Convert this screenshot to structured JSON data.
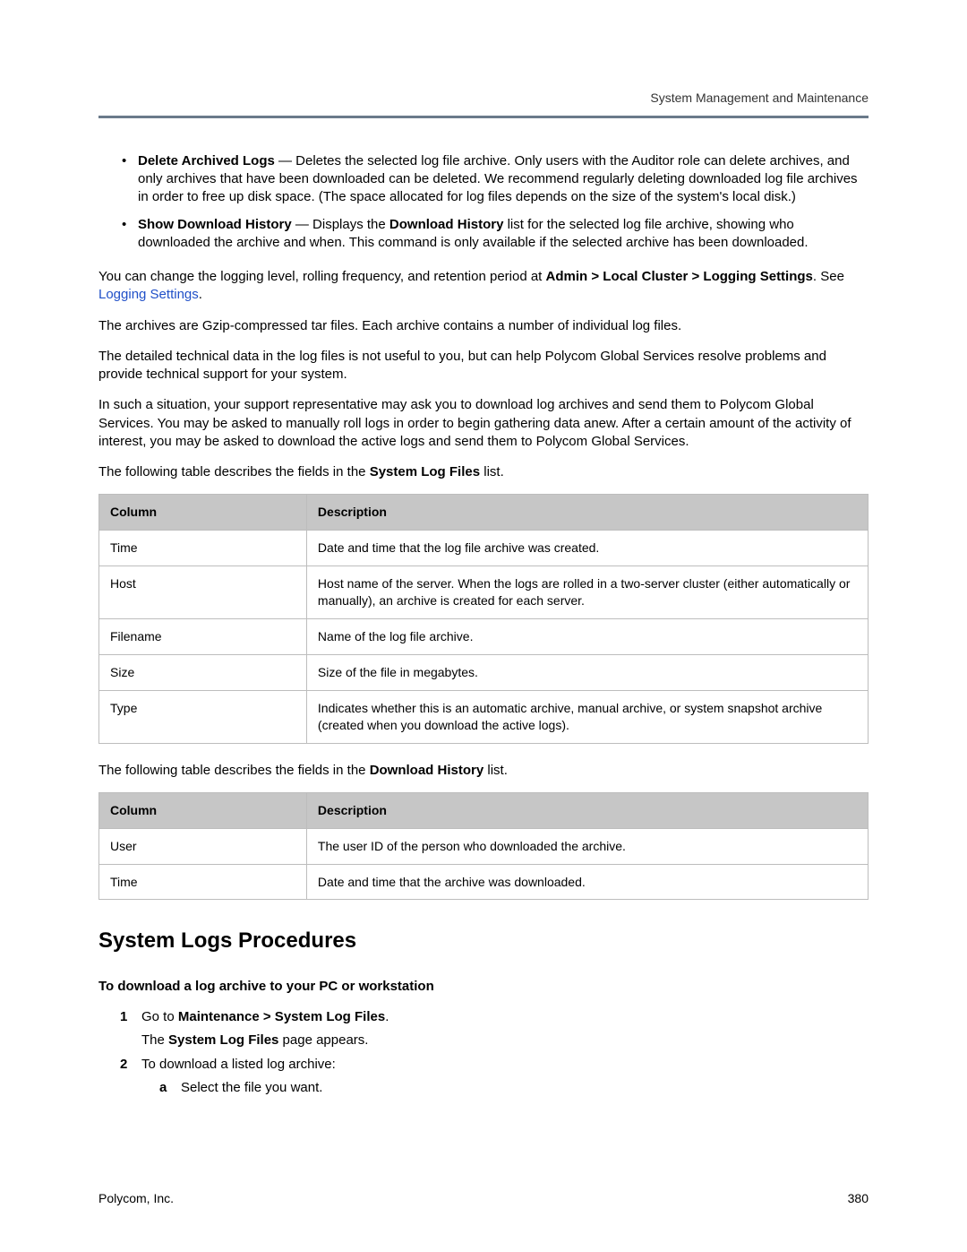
{
  "header": {
    "section": "System Management and Maintenance"
  },
  "bullets": [
    {
      "strong": "Delete Archived Logs",
      "rest": " — Deletes the selected log file archive. Only users with the Auditor role can delete archives, and only archives that have been downloaded can be deleted. We recommend regularly deleting downloaded log file archives in order to free up disk space. (The space allocated for log files depends on the size of the system's local disk.)"
    },
    {
      "strong": "Show Download History",
      "rest_before": " — Displays the ",
      "rest_mid_bold": "Download History",
      "rest_after": " list for the selected log file archive, showing who downloaded the archive and when. This command is only available if the selected archive has been downloaded."
    }
  ],
  "para_change_a": "You can change the logging level, rolling frequency, and retention period at ",
  "para_change_bold": "Admin > Local Cluster > Logging Settings",
  "para_change_b": ". See ",
  "para_change_link": "Logging Settings",
  "para_change_c": ".",
  "para_archives": "The archives are Gzip-compressed tar files. Each archive contains a number of individual log files.",
  "para_technical": "The detailed technical data in the log files is not useful to you, but can help Polycom Global Services resolve problems and provide technical support for your system.",
  "para_support": "In such a situation, your support representative may ask you to download log archives and send them to Polycom Global Services. You may be asked to manually roll logs in order to begin gathering data anew. After a certain amount of the activity of interest, you may be asked to download the active logs and send them to Polycom Global Services.",
  "para_table1_intro_a": "The following table describes the fields in the ",
  "para_table1_intro_bold": "System Log Files",
  "para_table1_intro_b": " list.",
  "table1": {
    "head": {
      "c1": "Column",
      "c2": "Description"
    },
    "rows": [
      {
        "c1": "Time",
        "c2": "Date and time that the log file archive was created."
      },
      {
        "c1": "Host",
        "c2": "Host name of the server. When the logs are rolled in a two-server cluster (either automatically or manually), an archive is created for each server."
      },
      {
        "c1": "Filename",
        "c2": "Name of the log file archive."
      },
      {
        "c1": "Size",
        "c2": "Size of the file in megabytes."
      },
      {
        "c1": "Type",
        "c2": "Indicates whether this is an automatic archive, manual archive, or system snapshot archive (created when you download the active logs)."
      }
    ]
  },
  "para_table2_intro_a": "The following table describes the fields in the ",
  "para_table2_intro_bold": "Download History",
  "para_table2_intro_b": " list.",
  "table2": {
    "head": {
      "c1": "Column",
      "c2": "Description"
    },
    "rows": [
      {
        "c1": "User",
        "c2": "The user ID of the person who downloaded the archive."
      },
      {
        "c1": "Time",
        "c2": "Date and time that the archive was downloaded."
      }
    ]
  },
  "section_heading": "System Logs Procedures",
  "subhead": "To download a log archive to your PC or workstation",
  "steps": {
    "n1": "1",
    "s1_a": "Go to ",
    "s1_bold": "Maintenance > System Log Files",
    "s1_b": ".",
    "s1_line2_a": "The ",
    "s1_line2_bold": "System Log Files",
    "s1_line2_b": " page appears.",
    "n2": "2",
    "s2": "To download a listed log archive:",
    "sa_letter": "a",
    "sa_text": "Select the file you want."
  },
  "footer": {
    "left": "Polycom, Inc.",
    "right": "380"
  }
}
